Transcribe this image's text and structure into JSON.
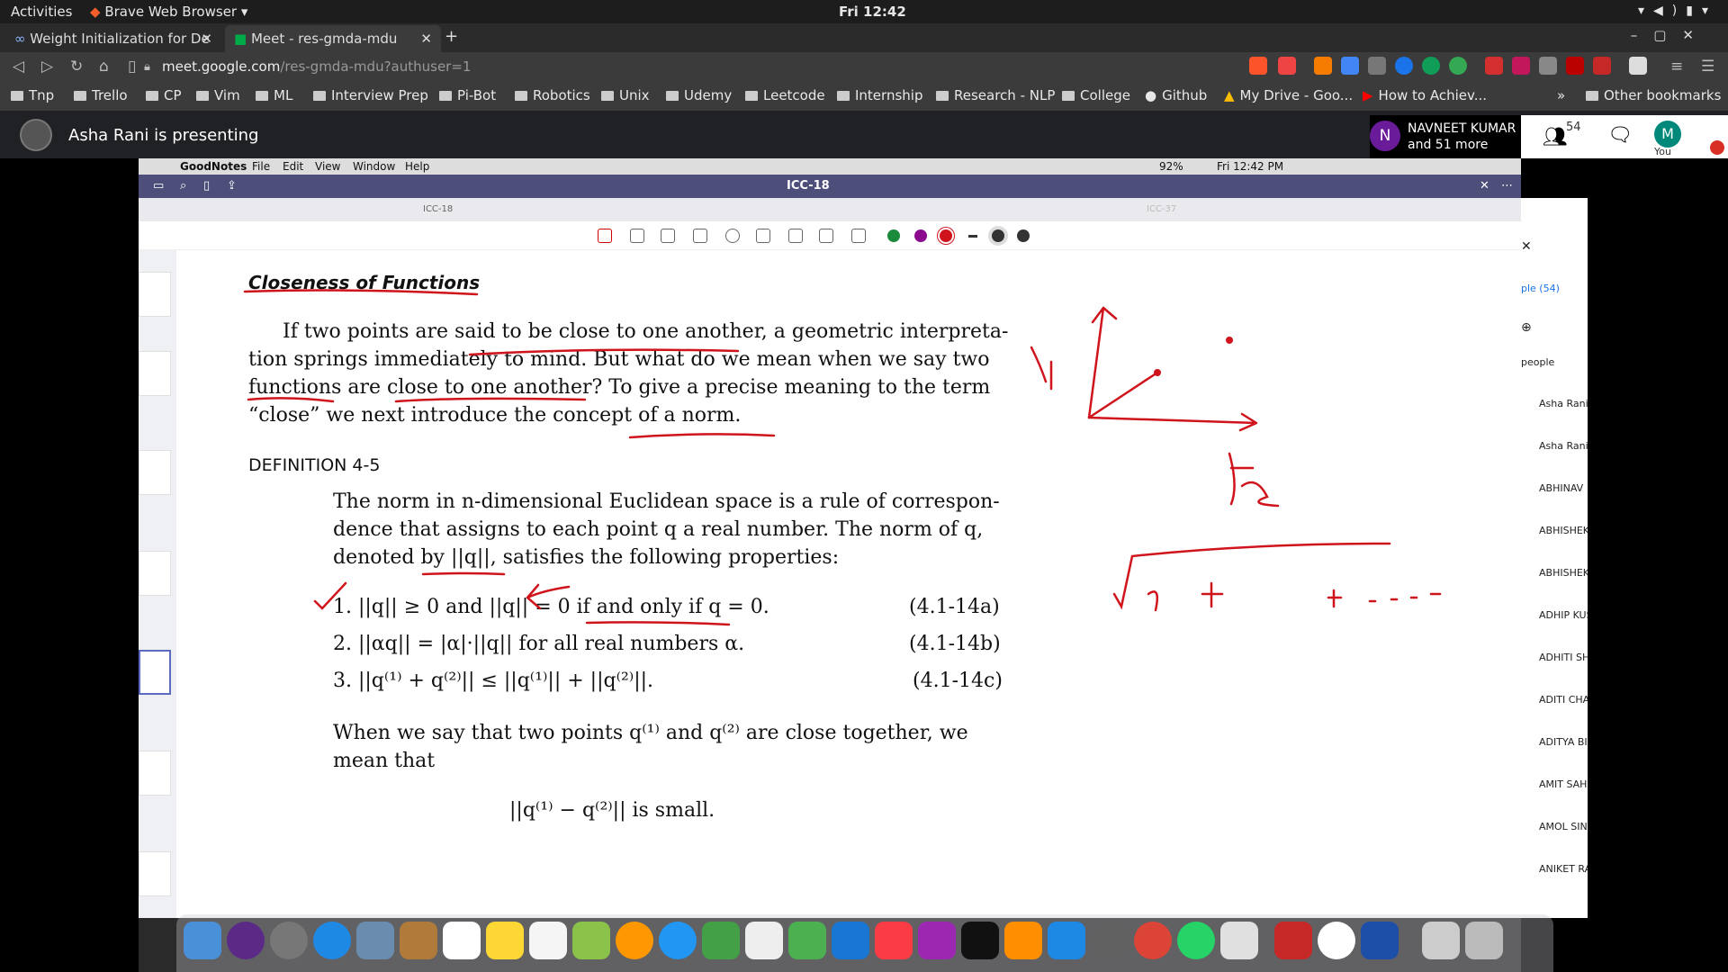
{
  "gnome": {
    "activities": "Activities",
    "browser": "Brave Web Browser",
    "clock": "Fri 12:42"
  },
  "tabs": [
    {
      "label": "Weight Initialization for De"
    },
    {
      "label": "Meet - res-gmda-mdu"
    }
  ],
  "address": {
    "host": "meet.google.com",
    "path": "/res-gmda-mdu?authuser=1"
  },
  "bookmarks": [
    "Tnp",
    "Trello",
    "CP",
    "Vim",
    "ML",
    "Interview Prep",
    "Pi-Bot",
    "Robotics",
    "Unix",
    "Udemy",
    "Leetcode",
    "Internship",
    "Research - NLP",
    "College",
    "Github",
    "My Drive - Goo...",
    "How to Achiev..."
  ],
  "other_bookmarks": "Other bookmarks",
  "meet": {
    "presenting": "Asha Rani is presenting",
    "viewer_initial": "N",
    "viewer_name": "NAVNEET KUMAR",
    "viewer_more": "and 51 more",
    "participant_count": "54",
    "you_initial": "M",
    "you_label": "You",
    "panel_people": "ple (54)",
    "panel_people_label": "people",
    "participants": [
      "Asha Rani (",
      "Asha Rani (",
      "ABHINAV",
      "ABHISHEK",
      "ABHISHEK",
      "ADHIP KUS",
      "ADHITI SHA",
      "ADITI CHAV",
      "ADITYA BIS",
      "AMIT SAHU",
      "AMOL SING",
      "ANIKET RA"
    ]
  },
  "mac": {
    "app": "GoodNotes",
    "menu": [
      "File",
      "Edit",
      "View",
      "Window",
      "Help"
    ],
    "battery": "92%",
    "time": "Fri 12:42 PM"
  },
  "goodnotes": {
    "doc_title": "ICC-18",
    "tab_left": "ICC-18",
    "tab_right": "ICC-37"
  },
  "doc": {
    "heading": "Closeness of Functions",
    "para1": [
      "If two points are said to be close to one another, a geometric interpreta-",
      "tion springs immediately to mind. But what do we mean when we say two",
      "functions are close to one another? To give a precise meaning to the term",
      "“close” we next introduce the concept of a norm."
    ],
    "definition": "DEFINITION 4-5",
    "def_text": [
      "The norm in n-dimensional Euclidean space is a rule of correspon-",
      "dence that assigns to each point q a real number. The norm of q,",
      "denoted by ||q||, satisfies the following properties:"
    ],
    "props": [
      {
        "text": "1. ||q|| ≥ 0 and ||q|| = 0 if and only if q = 0.",
        "eq": "(4.1-14a)"
      },
      {
        "text": "2. ||αq|| = |α|·||q|| for all real numbers α.",
        "eq": "(4.1-14b)"
      },
      {
        "text": "3. ||q⁽¹⁾ + q⁽²⁾|| ≤ ||q⁽¹⁾|| + ||q⁽²⁾||.",
        "eq": "(4.1-14c)"
      }
    ],
    "para2": [
      "When we say that two points q⁽¹⁾ and q⁽²⁾ are close together, we",
      "mean that"
    ],
    "small": "||q⁽¹⁾ − q⁽²⁾|| is small.",
    "hand_q1": "q1",
    "hand_f2": "f2"
  },
  "colors": {
    "ink": "#d0141c",
    "gn_bar": "#4d4e7a"
  }
}
